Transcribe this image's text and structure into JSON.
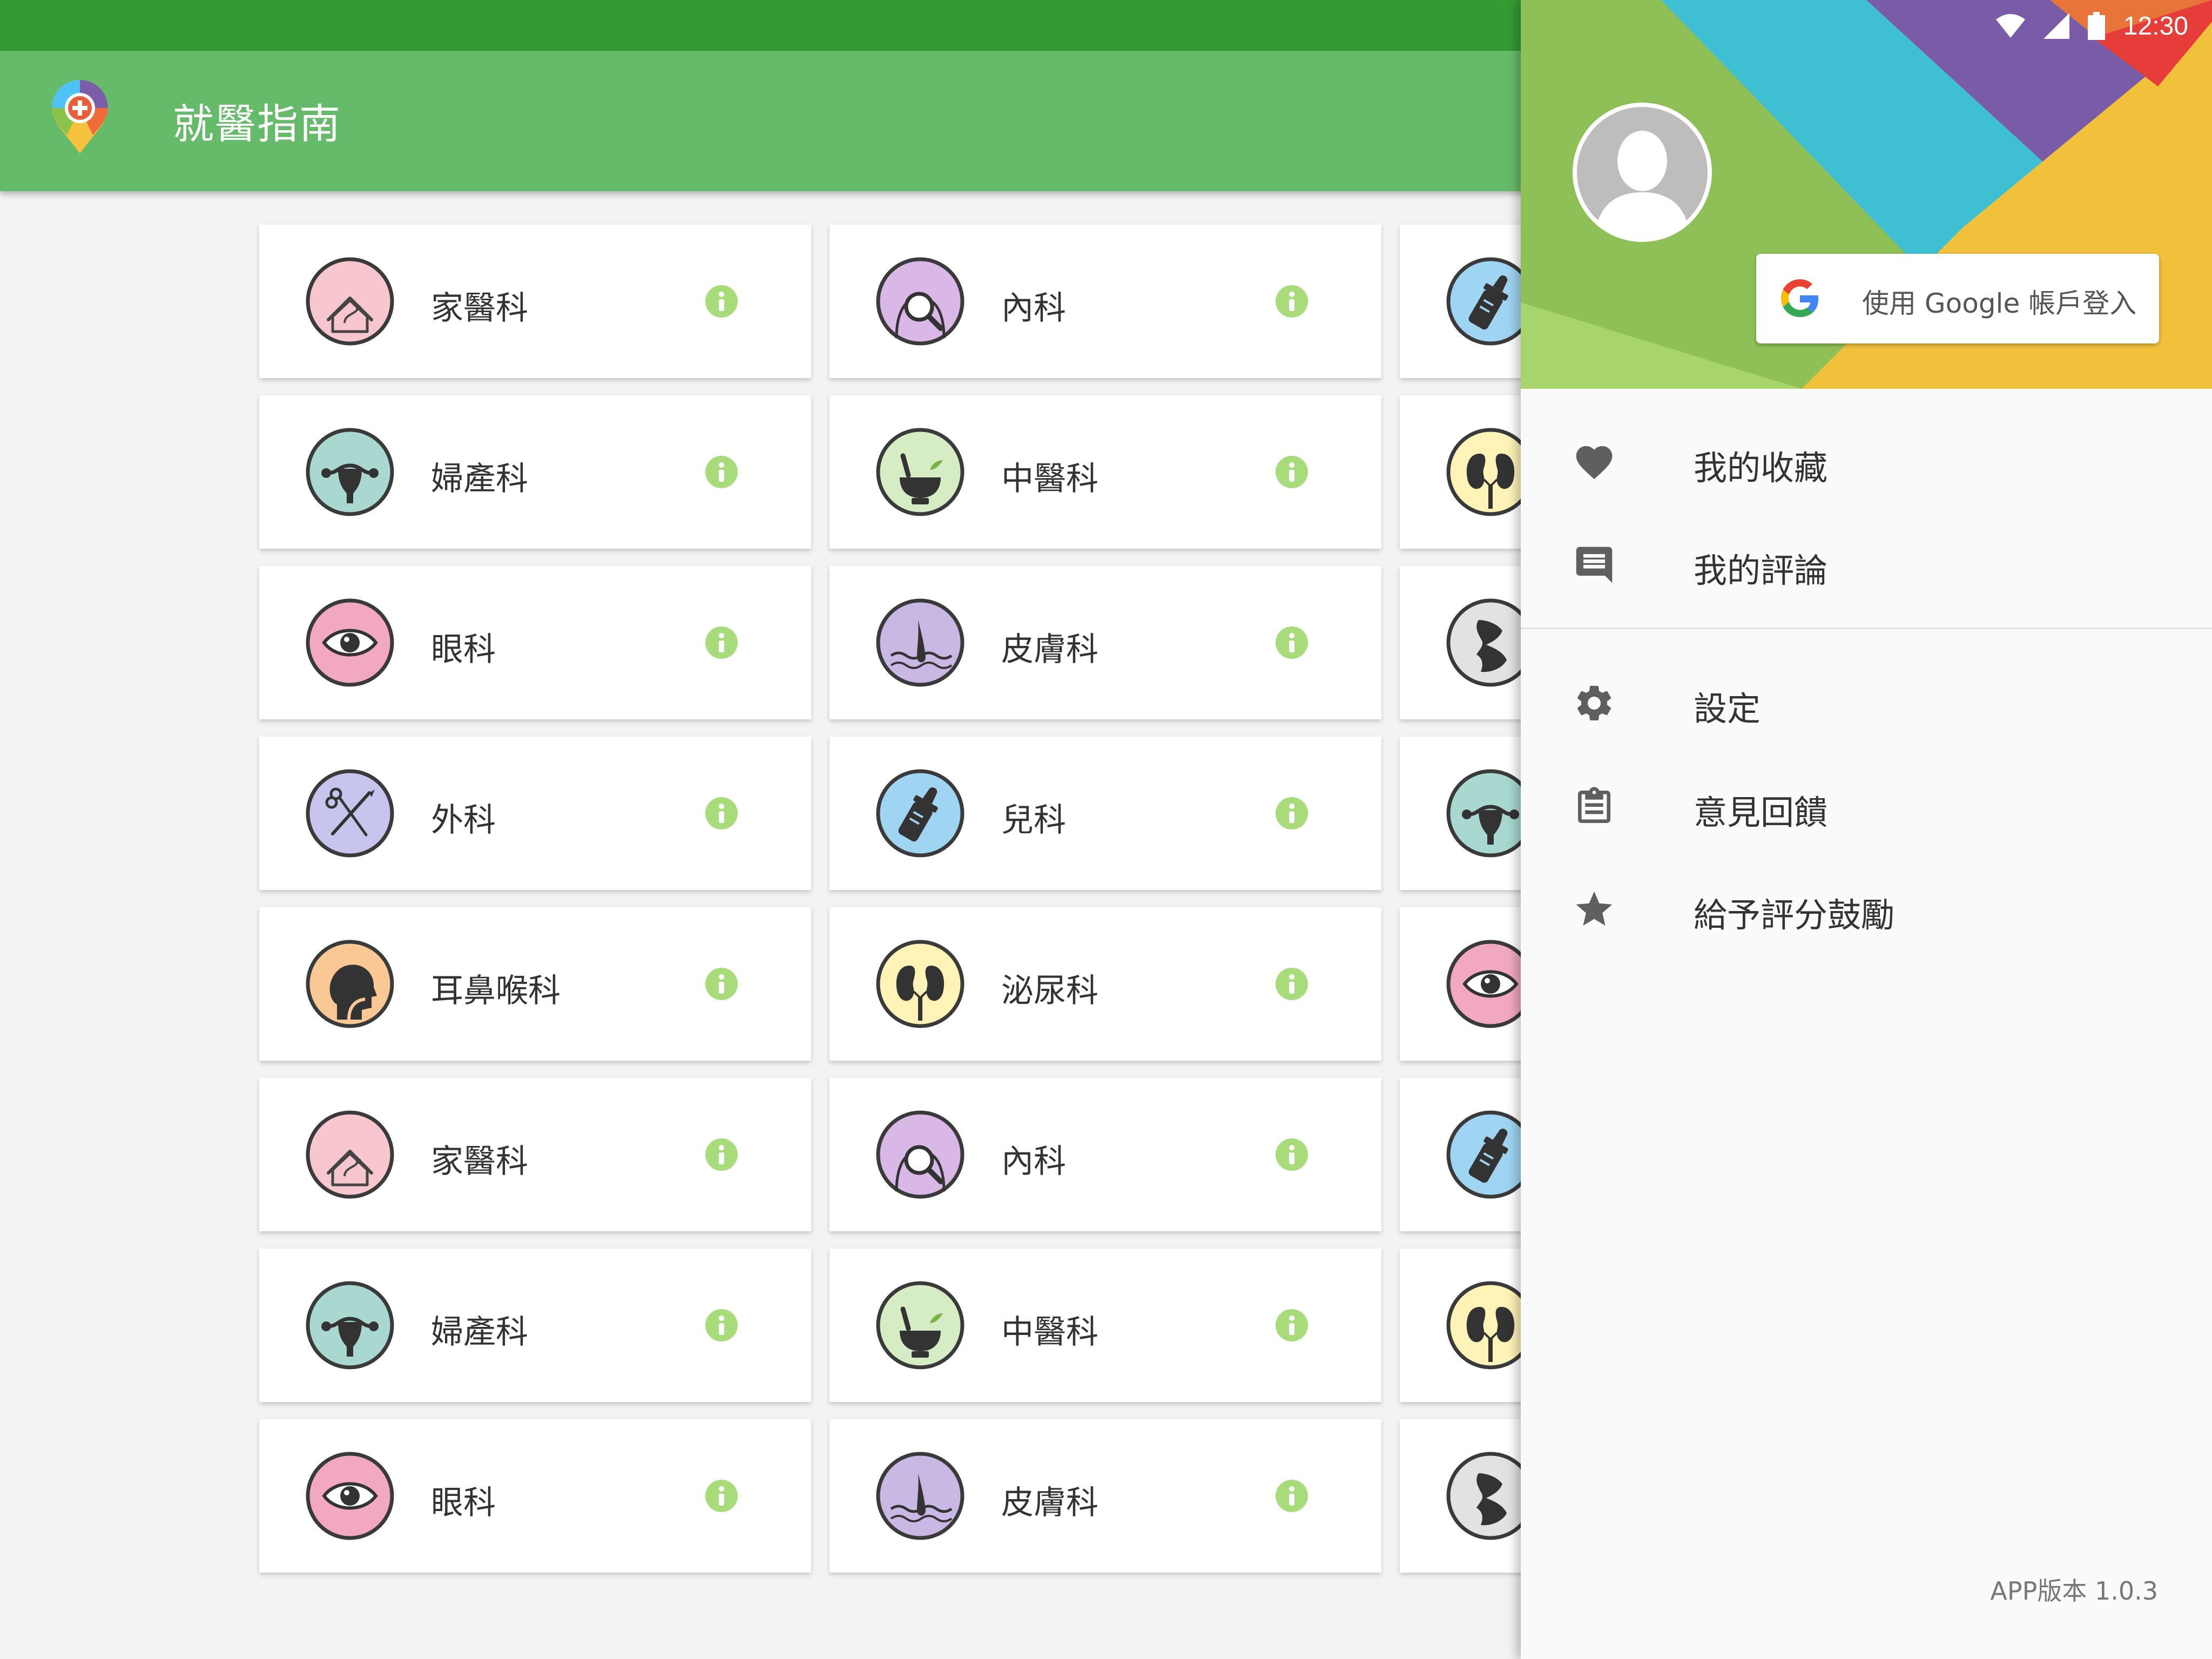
{
  "status_bar": {
    "time": "12:30"
  },
  "app": {
    "title": "就醫指南"
  },
  "grid": {
    "col1": [
      {
        "label": "家醫科",
        "icon": "house-stethoscope-icon",
        "color": "#f8c6cf"
      },
      {
        "label": "婦產科",
        "icon": "uterus-icon",
        "color": "#a8d8d0"
      },
      {
        "label": "眼科",
        "icon": "eye-icon",
        "color": "#f2a9c0"
      },
      {
        "label": "外科",
        "icon": "scalpel-scissors-icon",
        "color": "#c7c4ee"
      },
      {
        "label": "耳鼻喉科",
        "icon": "head-profile-icon",
        "color": "#f9c894"
      },
      {
        "label": "家醫科",
        "icon": "house-stethoscope-icon",
        "color": "#f8c6cf"
      },
      {
        "label": "婦產科",
        "icon": "uterus-icon",
        "color": "#a8d8d0"
      },
      {
        "label": "眼科",
        "icon": "eye-icon",
        "color": "#f2a9c0"
      }
    ],
    "col2": [
      {
        "label": "內科",
        "icon": "body-magnifier-icon",
        "color": "#d9b8e8"
      },
      {
        "label": "中醫科",
        "icon": "mortar-pestle-icon",
        "color": "#d6ecc4"
      },
      {
        "label": "皮膚科",
        "icon": "hair-follicle-icon",
        "color": "#c9b7e4"
      },
      {
        "label": "兒科",
        "icon": "baby-bottle-icon",
        "color": "#9fd4f3"
      },
      {
        "label": "泌尿科",
        "icon": "kidney-icon",
        "color": "#fff3b8"
      },
      {
        "label": "內科",
        "icon": "body-magnifier-icon",
        "color": "#d9b8e8"
      },
      {
        "label": "中醫科",
        "icon": "mortar-pestle-icon",
        "color": "#d6ecc4"
      },
      {
        "label": "皮膚科",
        "icon": "hair-follicle-icon",
        "color": "#c9b7e4"
      }
    ],
    "col3": [
      {
        "icon": "baby-bottle-icon",
        "color": "#9fd4f3"
      },
      {
        "icon": "kidney-icon",
        "color": "#fff3b8"
      },
      {
        "icon": "bone-joint-icon",
        "color": "#e2e2e2"
      },
      {
        "icon": "uterus-icon",
        "color": "#a8d8d0"
      },
      {
        "icon": "eye-icon",
        "color": "#f2a9c0"
      },
      {
        "icon": "baby-bottle-icon",
        "color": "#9fd4f3"
      },
      {
        "icon": "kidney-icon",
        "color": "#fff3b8"
      },
      {
        "icon": "bone-joint-icon",
        "color": "#e2e2e2"
      }
    ]
  },
  "drawer": {
    "google_button": {
      "label": "使用 Google 帳戶登入"
    },
    "menu": [
      {
        "label": "我的收藏",
        "icon": "heart-icon"
      },
      {
        "label": "我的評論",
        "icon": "comment-icon"
      },
      {
        "label": "設定",
        "icon": "gear-icon"
      },
      {
        "label": "意見回饋",
        "icon": "clipboard-icon"
      },
      {
        "label": "給予評分鼓勵",
        "icon": "star-icon"
      }
    ],
    "version": "APP版本 1.0.3"
  },
  "colors": {
    "status_bar": "#349b34",
    "app_bar": "#66bb6a",
    "info_icon": "#a8dc7a",
    "menu_icon": "#5f5f5f"
  }
}
